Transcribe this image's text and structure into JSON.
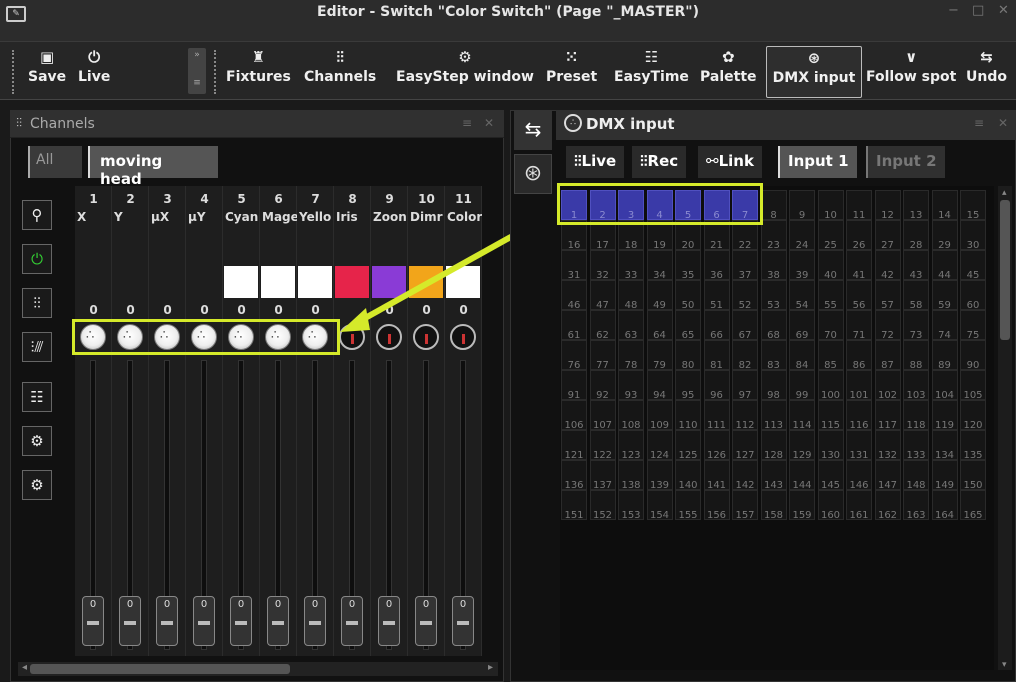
{
  "window": {
    "title": "Editor - Switch \"Color Switch\" (Page \"_MASTER\")",
    "minimize": "−",
    "maximize": "□",
    "close": "✕"
  },
  "toolbar": {
    "save": "Save",
    "live": "Live",
    "fixtures": "Fixtures",
    "channels": "Channels",
    "easystep": "EasyStep window",
    "preset": "Preset",
    "easytime": "EasyTime",
    "palette": "Palette",
    "dmx_input": "DMX input",
    "follow_spot": "Follow spot",
    "undo": "Undo"
  },
  "channels_panel": {
    "title": "Channels",
    "tabs": {
      "all": "All",
      "moving_head": "moving head"
    },
    "channels": [
      {
        "num": "1",
        "name": "X",
        "value": "0",
        "swatch": "",
        "knob": "dmx"
      },
      {
        "num": "2",
        "name": "Y",
        "value": "0",
        "swatch": "",
        "knob": "dmx"
      },
      {
        "num": "3",
        "name": "µX",
        "value": "0",
        "swatch": "",
        "knob": "dmx"
      },
      {
        "num": "4",
        "name": "µY",
        "value": "0",
        "swatch": "",
        "knob": "dmx"
      },
      {
        "num": "5",
        "name": "Cyan",
        "value": "0",
        "swatch": "#ffffff",
        "knob": "dmx"
      },
      {
        "num": "6",
        "name": "Mage",
        "value": "0",
        "swatch": "#ffffff",
        "knob": "dmx"
      },
      {
        "num": "7",
        "name": "Yello",
        "value": "0",
        "swatch": "#ffffff",
        "knob": "dmx"
      },
      {
        "num": "8",
        "name": "Iris",
        "value": "",
        "swatch": "#e6244a",
        "knob": "ctl"
      },
      {
        "num": "9",
        "name": "Zoon",
        "value": "0",
        "swatch": "#8a3bd6",
        "knob": "ctl"
      },
      {
        "num": "10",
        "name": "Dimr",
        "value": "0",
        "swatch": "#f2a51a",
        "knob": "ctl"
      },
      {
        "num": "11",
        "name": "Color",
        "value": "0",
        "swatch": "#ffffff",
        "knob": "ctl"
      }
    ],
    "fader_values": [
      "0",
      "0",
      "0",
      "0",
      "0",
      "0",
      "0",
      "0",
      "0",
      "0",
      "0"
    ]
  },
  "dmx_panel": {
    "title": "DMX input",
    "tabs": {
      "live": "Live",
      "rec": "Rec",
      "link": "Link",
      "input1": "Input 1",
      "input2": "Input 2"
    },
    "highlighted_count": 7,
    "rows": [
      [
        "1",
        "2",
        "3",
        "4",
        "5",
        "6",
        "7",
        "8",
        "9",
        "10",
        "11",
        "12",
        "13",
        "14",
        "15"
      ],
      [
        "16",
        "17",
        "18",
        "19",
        "20",
        "21",
        "22",
        "23",
        "24",
        "25",
        "26",
        "27",
        "28",
        "29",
        "30"
      ],
      [
        "31",
        "32",
        "33",
        "34",
        "35",
        "36",
        "37",
        "38",
        "39",
        "40",
        "41",
        "42",
        "43",
        "44",
        "45"
      ],
      [
        "46",
        "47",
        "48",
        "49",
        "50",
        "51",
        "52",
        "53",
        "54",
        "55",
        "56",
        "57",
        "58",
        "59",
        "60"
      ],
      [
        "61",
        "62",
        "63",
        "64",
        "65",
        "66",
        "67",
        "68",
        "69",
        "70",
        "71",
        "72",
        "73",
        "74",
        "75"
      ],
      [
        "76",
        "77",
        "78",
        "79",
        "80",
        "81",
        "82",
        "83",
        "84",
        "85",
        "86",
        "87",
        "88",
        "89",
        "90"
      ],
      [
        "91",
        "92",
        "93",
        "94",
        "95",
        "96",
        "97",
        "98",
        "99",
        "100",
        "101",
        "102",
        "103",
        "104",
        "105"
      ],
      [
        "106",
        "107",
        "108",
        "109",
        "110",
        "111",
        "112",
        "113",
        "114",
        "115",
        "116",
        "117",
        "118",
        "119",
        "120"
      ],
      [
        "121",
        "122",
        "123",
        "124",
        "125",
        "126",
        "127",
        "128",
        "129",
        "130",
        "131",
        "132",
        "133",
        "134",
        "135"
      ],
      [
        "136",
        "137",
        "138",
        "139",
        "140",
        "141",
        "142",
        "143",
        "144",
        "145",
        "146",
        "147",
        "148",
        "149",
        "150"
      ],
      [
        "151",
        "152",
        "153",
        "154",
        "155",
        "156",
        "157",
        "158",
        "159",
        "160",
        "161",
        "162",
        "163",
        "164",
        "165"
      ]
    ]
  },
  "colors": {
    "highlight": "#d5ea2a",
    "dmx_active": "#3a3aa8"
  }
}
